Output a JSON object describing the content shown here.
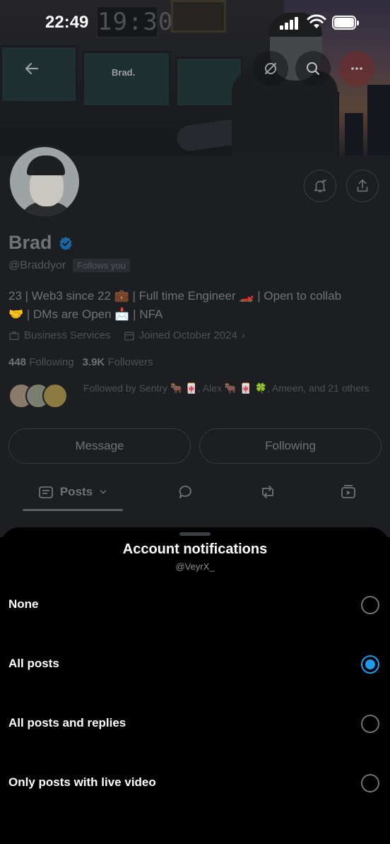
{
  "status_bar": {
    "time": "22:49"
  },
  "banner": {
    "clock_text": "19:30",
    "brand_text": "Brad."
  },
  "profile": {
    "name": "Brad",
    "handle": "@Braddyor",
    "follows_you": "Follows you",
    "bio_line1": "23 | Web3 since 22 💼 | Full time Engineer 🏎️ | Open to collab",
    "bio_line2": "🤝 | DMs are Open 📩 | NFA",
    "category": "Business Services",
    "joined": "Joined October 2024",
    "following_count": "448",
    "following_label": "Following",
    "followers_count": "3.9K",
    "followers_label": "Followers",
    "followed_by": "Followed by Sentry 🐂 🀄, Alex 🐂 🀄 🍀, Ameen, and 21 others"
  },
  "actions": {
    "message_label": "Message",
    "following_label": "Following"
  },
  "tabs": {
    "posts_label": "Posts"
  },
  "sheet": {
    "title": "Account notifications",
    "subtitle": "@VeyrX_",
    "options": [
      {
        "label": "None",
        "selected": false
      },
      {
        "label": "All posts",
        "selected": true
      },
      {
        "label": "All posts and replies",
        "selected": false
      },
      {
        "label": "Only posts with live video",
        "selected": false
      }
    ]
  },
  "colors": {
    "accent": "#1d9bf0",
    "sheet_bg": "#000000",
    "page_dim": "#1c1e22"
  },
  "icons": [
    "back-arrow-icon",
    "grok-icon",
    "search-icon",
    "more-icon",
    "bell-icon",
    "share-icon",
    "verified-icon",
    "briefcase-icon",
    "calendar-icon",
    "posts-icon",
    "chevron-down-icon",
    "reply-icon",
    "repost-icon",
    "video-icon"
  ]
}
